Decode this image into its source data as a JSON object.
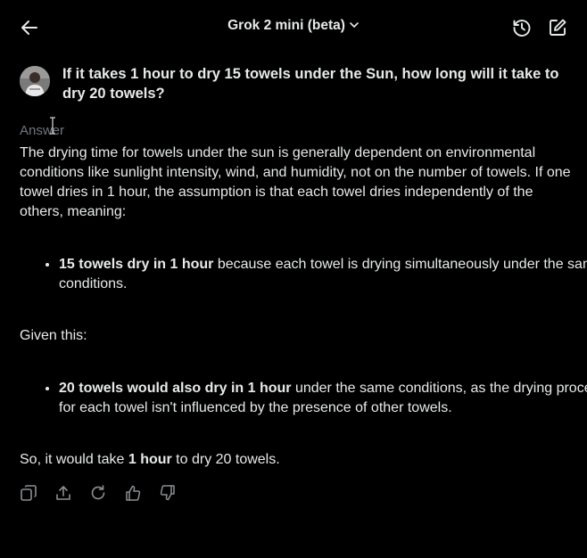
{
  "header": {
    "model_name": "Grok 2 mini (beta)"
  },
  "question": {
    "text": "If it takes 1 hour to dry 15 towels under the Sun, how long will it take to dry 20 towels?"
  },
  "answer": {
    "label": "Answer",
    "para1": "The drying time for towels under the sun is generally dependent on environmental conditions like sunlight intensity, wind, and humidity, not on the number of towels. If one towel dries in 1 hour, the assumption is that each towel dries independently of the others, meaning:",
    "bullet1_bold": "15 towels dry in 1 hour",
    "bullet1_rest": " because each towel is drying simultaneously under the same conditions.",
    "para2": "Given this:",
    "bullet2_bold": "20 towels would also dry in 1 hour",
    "bullet2_rest": " under the same conditions, as the drying process for each towel isn't influenced by the presence of other towels.",
    "para3_pre": "So, it would take ",
    "para3_bold": "1 hour",
    "para3_post": " to dry 20 towels."
  },
  "colors": {
    "background": "#000000",
    "text": "#e7e9ea",
    "muted": "#71767b"
  },
  "icons": {
    "back": "arrow-left-icon",
    "chevron": "chevron-down-icon",
    "history": "history-icon",
    "compose": "compose-icon",
    "copy": "copy-icon",
    "share": "share-icon",
    "regenerate": "regenerate-icon",
    "like": "thumbs-up-icon",
    "dislike": "thumbs-down-icon"
  }
}
